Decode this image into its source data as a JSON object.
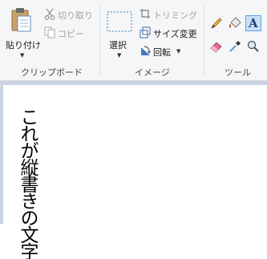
{
  "clipboard": {
    "paste_label": "貼り付け",
    "cut_label": "切り取り",
    "copy_label": "コピー",
    "group_label": "クリップボード"
  },
  "image": {
    "select_label": "選択",
    "crop_label": "トリミング",
    "resize_label": "サイズ変更",
    "rotate_label": "回転",
    "group_label": "イメージ"
  },
  "tools": {
    "group_label": "ツール",
    "icons": [
      "pencil-icon",
      "fill-icon",
      "text-icon",
      "eraser-icon",
      "color-picker-icon",
      "magnifier-icon"
    ]
  },
  "canvas": {
    "text": "これが縦書きの文字"
  },
  "colors": {
    "ribbon_bg": "#f5f6f7",
    "workspace_bg": "#c9d3e2",
    "active_tool_bg": "#c9e0f7",
    "active_tool_border": "#62a2e4"
  }
}
